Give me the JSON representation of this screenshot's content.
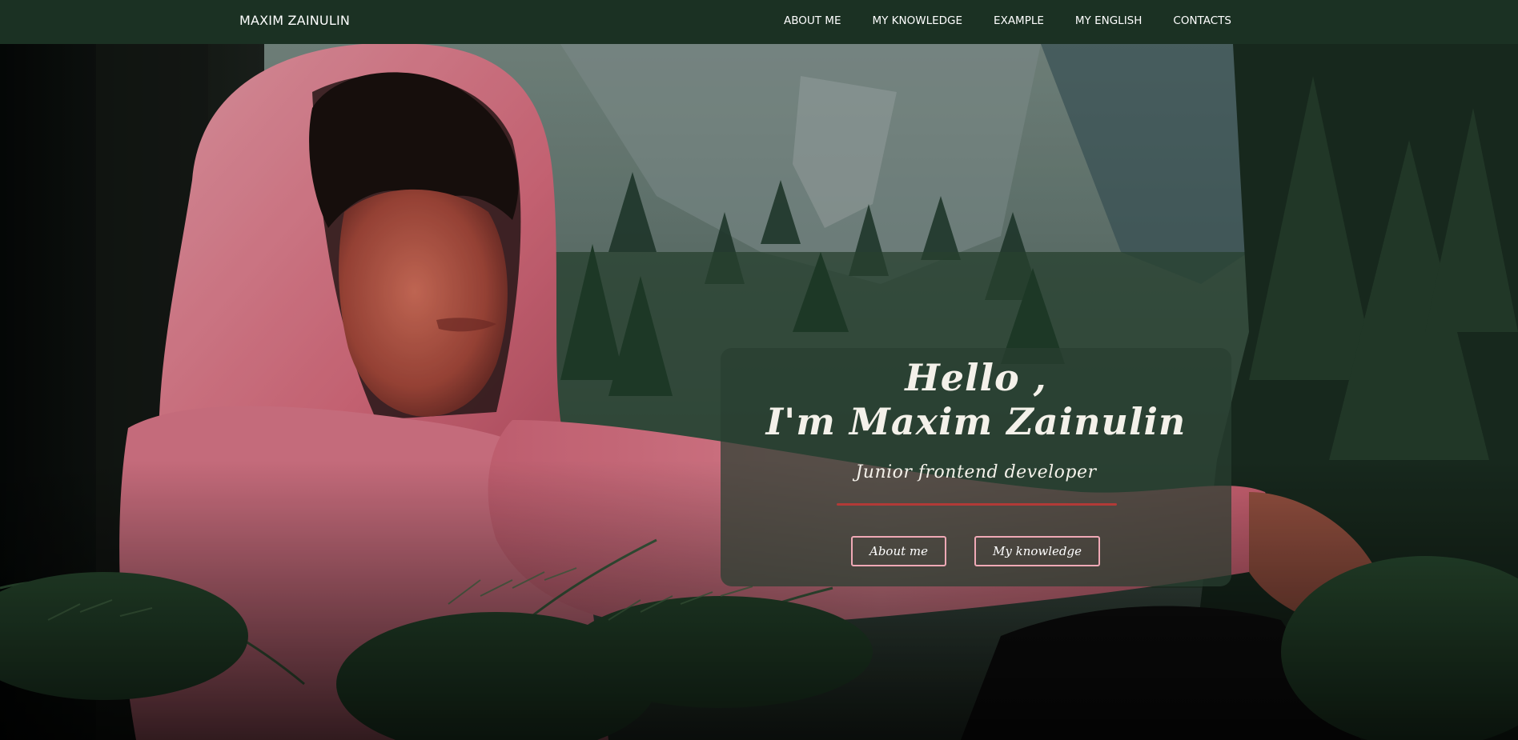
{
  "navbar": {
    "brand": "MAXIM ZAINULIN",
    "links": [
      {
        "label": "ABOUT ME"
      },
      {
        "label": "MY KNOWLEDGE"
      },
      {
        "label": "EXAMPLE"
      },
      {
        "label": "MY ENGLISH"
      },
      {
        "label": "CONTACTS"
      }
    ]
  },
  "hero": {
    "greeting_line1": "Hello ,",
    "greeting_line2": "I'm Maxim Zainulin",
    "subtitle": "Junior frontend developer",
    "buttons": {
      "about": "About me",
      "knowledge": "My knowledge"
    }
  },
  "colors": {
    "navbar_bg": "#1b3123",
    "card_bg": "#283e30",
    "divider": "#b23a37",
    "button_border": "#f0a9b6",
    "hoodie": "#e27d8e"
  }
}
